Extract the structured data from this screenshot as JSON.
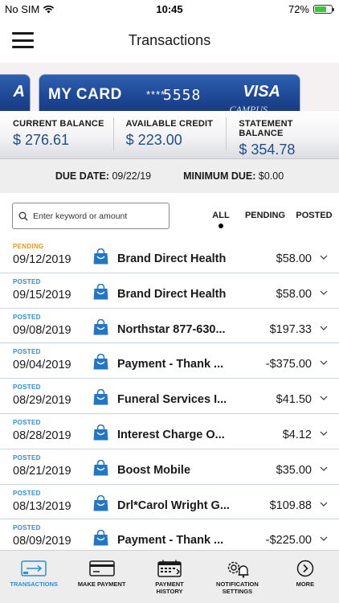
{
  "status_bar": {
    "carrier": "No SIM",
    "time": "10:45",
    "battery": "72%",
    "battery_level": 0.72
  },
  "header": {
    "title": "Transactions"
  },
  "cards": {
    "prev_visa_fragment": "A",
    "main": {
      "name": "MY CARD",
      "masked": "****",
      "last4": "5558",
      "brand": "VISA",
      "issuer_fragment": "CAMPUS"
    }
  },
  "balances": [
    {
      "label": "CURRENT BALANCE",
      "value": "$ 276.61"
    },
    {
      "label": "AVAILABLE CREDIT",
      "value": "$ 223.00"
    },
    {
      "label": "STATEMENT BALANCE",
      "value": "$ 354.78"
    }
  ],
  "due": {
    "date_label": "DUE DATE:",
    "date_value": "09/22/19",
    "min_label": "MINIMUM DUE:",
    "min_value": "$0.00"
  },
  "search": {
    "placeholder": "Enter keyword or amount"
  },
  "filters": {
    "all": "ALL",
    "pending": "PENDING",
    "posted": "POSTED",
    "selected": "all"
  },
  "colors": {
    "pending": "#f0961e",
    "posted": "#2a8fd6",
    "accent": "#1f4e8c",
    "bag_icon": "#2176c6"
  },
  "transactions": [
    {
      "status": "PENDING",
      "date": "09/12/2019",
      "desc": "Brand Direct Health",
      "amount": "$58.00"
    },
    {
      "status": "POSTED",
      "date": "09/15/2019",
      "desc": "Brand Direct Health",
      "amount": "$58.00"
    },
    {
      "status": "POSTED",
      "date": "09/08/2019",
      "desc": "Northstar 877-630...",
      "amount": "$197.33"
    },
    {
      "status": "POSTED",
      "date": "09/04/2019",
      "desc": "Payment - Thank ...",
      "amount": "-$375.00"
    },
    {
      "status": "POSTED",
      "date": "08/29/2019",
      "desc": "Funeral Services I...",
      "amount": "$41.50"
    },
    {
      "status": "POSTED",
      "date": "08/28/2019",
      "desc": "Interest Charge O...",
      "amount": "$4.12"
    },
    {
      "status": "POSTED",
      "date": "08/21/2019",
      "desc": "Boost Mobile",
      "amount": "$35.00"
    },
    {
      "status": "POSTED",
      "date": "08/13/2019",
      "desc": "Drl*Carol Wright G...",
      "amount": "$109.88"
    },
    {
      "status": "POSTED",
      "date": "08/09/2019",
      "desc": "Payment - Thank ...",
      "amount": "-$225.00"
    }
  ],
  "tabs": [
    {
      "id": "transactions",
      "label": "TRANSACTIONS",
      "icon": "transactions-icon",
      "active": true
    },
    {
      "id": "make-payment",
      "label": "MAKE PAYMENT",
      "icon": "card-icon",
      "active": false
    },
    {
      "id": "payment-history",
      "label": "PAYMENT\nHISTORY",
      "icon": "calendar-icon",
      "active": false
    },
    {
      "id": "notification-settings",
      "label": "NOTIFICATION\nSETTINGS",
      "icon": "gear-bell-icon",
      "active": false
    },
    {
      "id": "more",
      "label": "MORE",
      "icon": "chevron-right-circle-icon",
      "active": false
    }
  ]
}
